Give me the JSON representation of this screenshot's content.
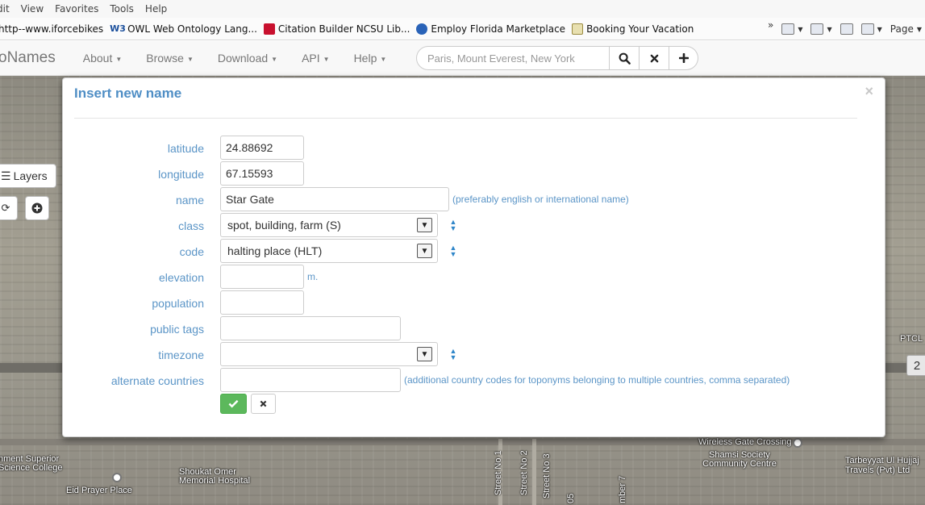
{
  "browser": {
    "menu": [
      "dit",
      "View",
      "Favorites",
      "Tools",
      "Help"
    ],
    "favorites": [
      {
        "label": "http--www.iforcebikes",
        "icon": "page-icon"
      },
      {
        "label": "OWL Web Ontology Lang...",
        "icon": "w3c-icon"
      },
      {
        "label": "Citation Builder  NCSU Lib...",
        "icon": "ncsu-icon"
      },
      {
        "label": "Employ Florida Marketplace",
        "icon": "florida-icon"
      },
      {
        "label": "Booking Your Vacation",
        "icon": "page-icon"
      }
    ],
    "chevron": "»",
    "page_label": "Page"
  },
  "navbar": {
    "brand": "oNames",
    "items": [
      "About",
      "Browse",
      "Download",
      "API",
      "Help"
    ],
    "search_placeholder": "Paris, Mount Everest, New York",
    "search_icon": "search-icon",
    "clear_icon": "close-icon",
    "add_icon": "plus-icon"
  },
  "map": {
    "layers_label": "Layers",
    "badge_value": "2",
    "labels": [
      "Wireless Gate Crossing",
      "Shamsi Society Community Centre",
      "Tarbeyyat Ul Hujjaj Travels (Pvt) Ltd",
      "nment Superior Science College",
      "Eid Prayer Place",
      "Shoukat Omer Memorial Hospital",
      "PTCL",
      "Street No 1",
      "Street No 2",
      "Street No 3",
      "05",
      "mber 7"
    ]
  },
  "modal": {
    "title": "Insert new name",
    "close": "×",
    "fields": {
      "latitude": {
        "label": "latitude",
        "value": "24.88692"
      },
      "longitude": {
        "label": "longitude",
        "value": "67.15593"
      },
      "name": {
        "label": "name",
        "value": "Star Gate",
        "hint": "(preferably english or international name)"
      },
      "class": {
        "label": "class",
        "value": "spot, building, farm (S)"
      },
      "code": {
        "label": "code",
        "value": "halting place (HLT)"
      },
      "elevation": {
        "label": "elevation",
        "value": "",
        "unit": "m."
      },
      "population": {
        "label": "population",
        "value": ""
      },
      "public_tags": {
        "label": "public tags",
        "value": ""
      },
      "timezone": {
        "label": "timezone",
        "value": ""
      },
      "alternate_countries": {
        "label": "alternate countries",
        "value": "",
        "hint": "(additional country codes for toponyms belonging to multiple countries, comma separated)"
      }
    },
    "ok_icon": "check-icon",
    "cancel_icon": "close-icon"
  },
  "colors": {
    "label_blue": "#5b95c7",
    "title_blue": "#4f8ec5",
    "ok_green": "#5cb85c",
    "sort_blue": "#2f86c9"
  }
}
